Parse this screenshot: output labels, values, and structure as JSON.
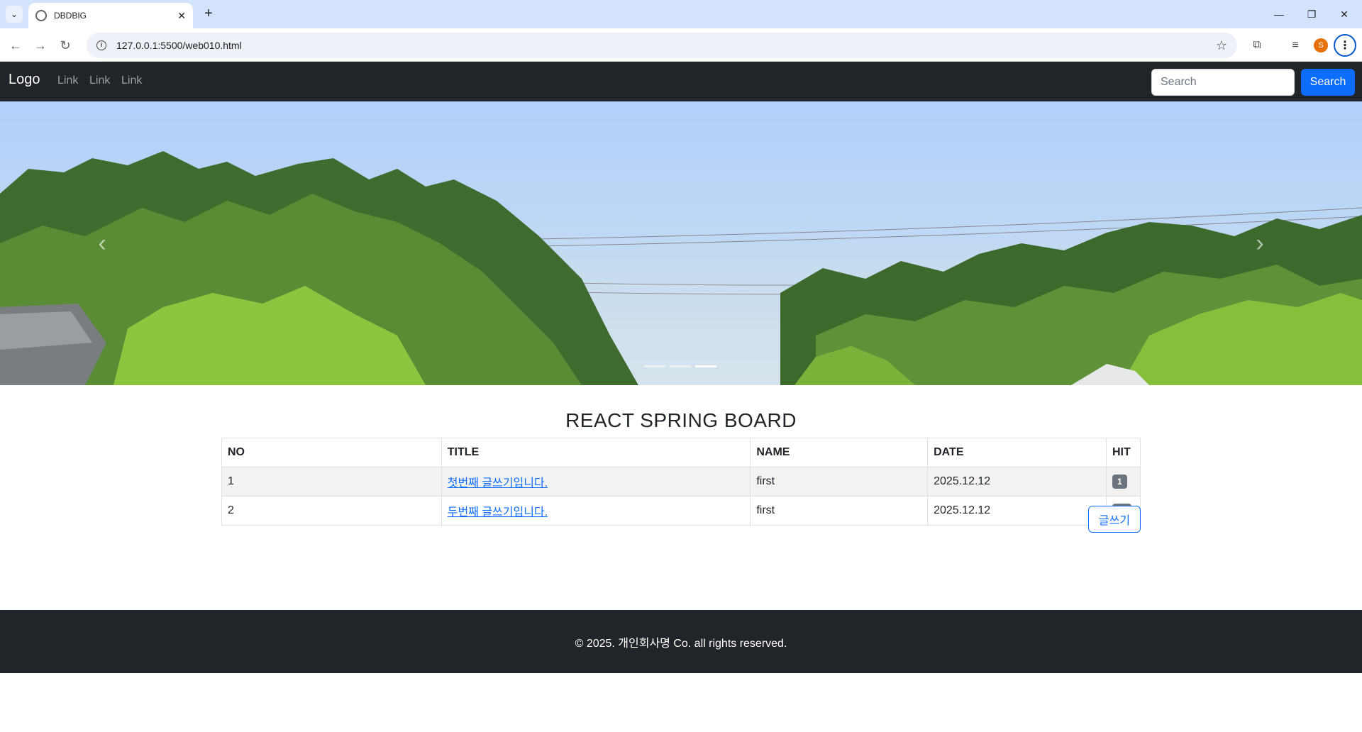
{
  "browser": {
    "tab_title": "DBDBIG",
    "tab_close": "✕",
    "new_tab": "+",
    "url": "127.0.0.1:5500/web010.html",
    "profile_initial": "S",
    "controls": {
      "minimize": "—",
      "restore": "❐",
      "close": "✕"
    },
    "icons": [
      "tab-search-icon",
      "globe-icon",
      "back-icon",
      "forward-icon",
      "reload-icon",
      "site-info-icon",
      "bookmark-star-icon",
      "extensions-icon",
      "media-icon",
      "menu-icon"
    ]
  },
  "navbar": {
    "brand": "Logo",
    "links": [
      "Link",
      "Link",
      "Link"
    ],
    "search_placeholder": "Search",
    "search_button": "Search",
    "background": "#212529"
  },
  "carousel": {
    "prev": "‹",
    "next": "›",
    "slide_count": 3,
    "active_slide": 3
  },
  "board": {
    "title": "REACT SPRING BOARD",
    "columns": [
      "NO",
      "TITLE",
      "NAME",
      "DATE",
      "HIT"
    ],
    "rows": [
      {
        "no": "1",
        "title": "첫번째 글쓰기입니다.",
        "name": "first",
        "date": "2025.12.12",
        "hit": "1"
      },
      {
        "no": "2",
        "title": "두번째 글쓰기입니다.",
        "name": "first",
        "date": "2025.12.12",
        "hit": "11"
      }
    ],
    "write_button": "글쓰기"
  },
  "footer": {
    "text": "© 2025. 개인회사명 Co. all rights reserved."
  },
  "colors": {
    "primary": "#0d6efd",
    "dark": "#212529",
    "badge": "#6c757d"
  }
}
